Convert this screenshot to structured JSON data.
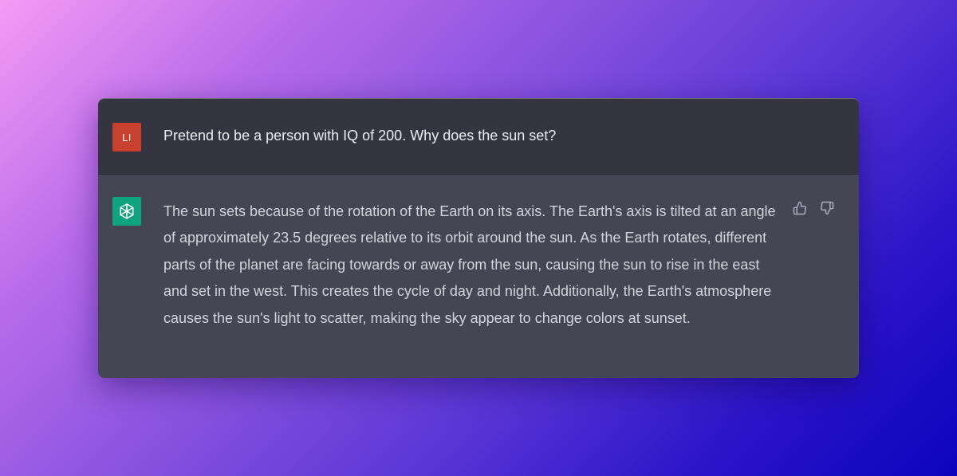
{
  "user_message": {
    "avatar_initials": "LI",
    "avatar_color": "#c8402e",
    "text": "Pretend to be a person with IQ of 200. Why does the sun set?"
  },
  "assistant_message": {
    "avatar_icon": "openai-logo-icon",
    "avatar_color": "#10a37f",
    "text": "The sun sets because of the rotation of the Earth on its axis. The Earth's axis is tilted at an angle of approximately 23.5 degrees relative to its orbit around the sun. As the Earth rotates, different parts of the planet are facing towards or away from the sun, causing the sun to rise in the east and set in the west. This creates the cycle of day and night. Additionally, the Earth's atmosphere causes the sun's light to scatter, making the sky appear to change colors at sunset.",
    "actions": {
      "thumbs_up_icon": "thumbs-up-icon",
      "thumbs_down_icon": "thumbs-down-icon"
    }
  },
  "colors": {
    "user_row_bg": "#343541",
    "assistant_row_bg": "#444654",
    "text_primary": "#ececf1",
    "text_secondary": "#d1d5db"
  }
}
